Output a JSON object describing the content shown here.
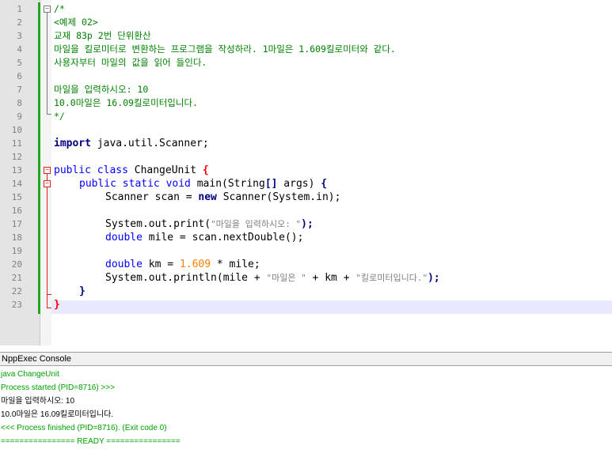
{
  "editor": {
    "line_numbers": [
      "1",
      "2",
      "3",
      "4",
      "5",
      "6",
      "7",
      "8",
      "9",
      "10",
      "11",
      "12",
      "13",
      "14",
      "15",
      "16",
      "17",
      "18",
      "19",
      "20",
      "21",
      "22",
      "23"
    ],
    "lines": {
      "l1": "/*",
      "l2": "<예제 02>",
      "l3": "교재 83p 2번 단위환산",
      "l4": "마일을 킬로미터로 변환하는 프로그램을 작성하라. 1마일은 1.609킬로미터와 같다.",
      "l5": "사용자부터 마일의 값을 읽어 들인다.",
      "l7": "마일을 입력하시오: 10",
      "l8": "10.0마일은 16.09킬로미터입니다.",
      "l9": "*/",
      "l11_kw": "import",
      "l11_rest": " java.util.Scanner;",
      "l13_kw": "public class",
      "l13_rest": " ChangeUnit ",
      "l13_brace": "{",
      "l14_kw": "public static void",
      "l14_rest": " main(String",
      "l14_arr": "[]",
      "l14_rest2": " args) ",
      "l14_brace": "{",
      "l15_a": "Scanner scan = ",
      "l15_new": "new",
      "l15_b": " Scanner(System.in);",
      "l17_a": "System.out.print(",
      "l17_str": "\"마일을 입력하시오: \"",
      "l17_b": ");",
      "l18_kw": "double",
      "l18_rest": " mile = scan.nextDouble();",
      "l20_kw": "double",
      "l20_a": " km = ",
      "l20_num": "1.609",
      "l20_b": " * mile;",
      "l21_a": "System.out.println(mile + ",
      "l21_str1": "\"마일은 \"",
      "l21_b": " + km + ",
      "l21_str2": "\"킬로미터입니다.\"",
      "l21_c": ");",
      "l22": "}",
      "l23": "}"
    }
  },
  "console": {
    "title": "NppExec Console",
    "lines": [
      "java ChangeUnit",
      "Process started (PID=8716) >>>",
      "마일을 입력하시오: 10",
      "10.0마일은 16.09킬로미터입니다.",
      "<<< Process finished (PID=8716). (Exit code 0)",
      "================ READY ================"
    ]
  },
  "colors": {
    "comment": "#008000",
    "keyword": "#0000ff",
    "brace": "#ff0000",
    "string": "#808080",
    "number": "#ff8000",
    "console_status": "#00a000",
    "current_line": "#e8e8ff"
  }
}
